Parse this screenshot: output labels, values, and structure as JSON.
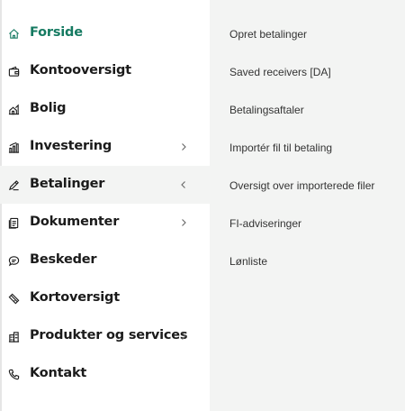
{
  "sidebar": {
    "items": [
      {
        "label": "Forside",
        "icon": "home-icon",
        "current": true
      },
      {
        "label": "Kontooversigt",
        "icon": "wallet-icon"
      },
      {
        "label": "Bolig",
        "icon": "house-chart-icon"
      },
      {
        "label": "Investering",
        "icon": "bar-chart-icon",
        "chevron": "right"
      },
      {
        "label": "Betalinger",
        "icon": "pen-icon",
        "chevron": "left"
      },
      {
        "label": "Dokumenter",
        "icon": "document-icon",
        "chevron": "right"
      },
      {
        "label": "Beskeder",
        "icon": "chat-bubble-icon"
      },
      {
        "label": "Kortoversigt",
        "icon": "card-icon"
      },
      {
        "label": "Produkter og services",
        "icon": "building-icon",
        "chevron": "right"
      },
      {
        "label": "Kontakt",
        "icon": "phone-icon"
      }
    ]
  },
  "submenu": {
    "items": [
      {
        "label": "Opret betalinger"
      },
      {
        "label": "Saved receivers [DA]"
      },
      {
        "label": "Betalingsaftaler"
      },
      {
        "label": "Importér fil til betaling"
      },
      {
        "label": "Oversigt over importerede filer"
      },
      {
        "label": "FI-adviseringer"
      },
      {
        "label": "Lønliste"
      }
    ]
  },
  "colors": {
    "accent": "#157a61",
    "text": "#1b1b1b",
    "submenu_bg": "#f3f4f3"
  }
}
